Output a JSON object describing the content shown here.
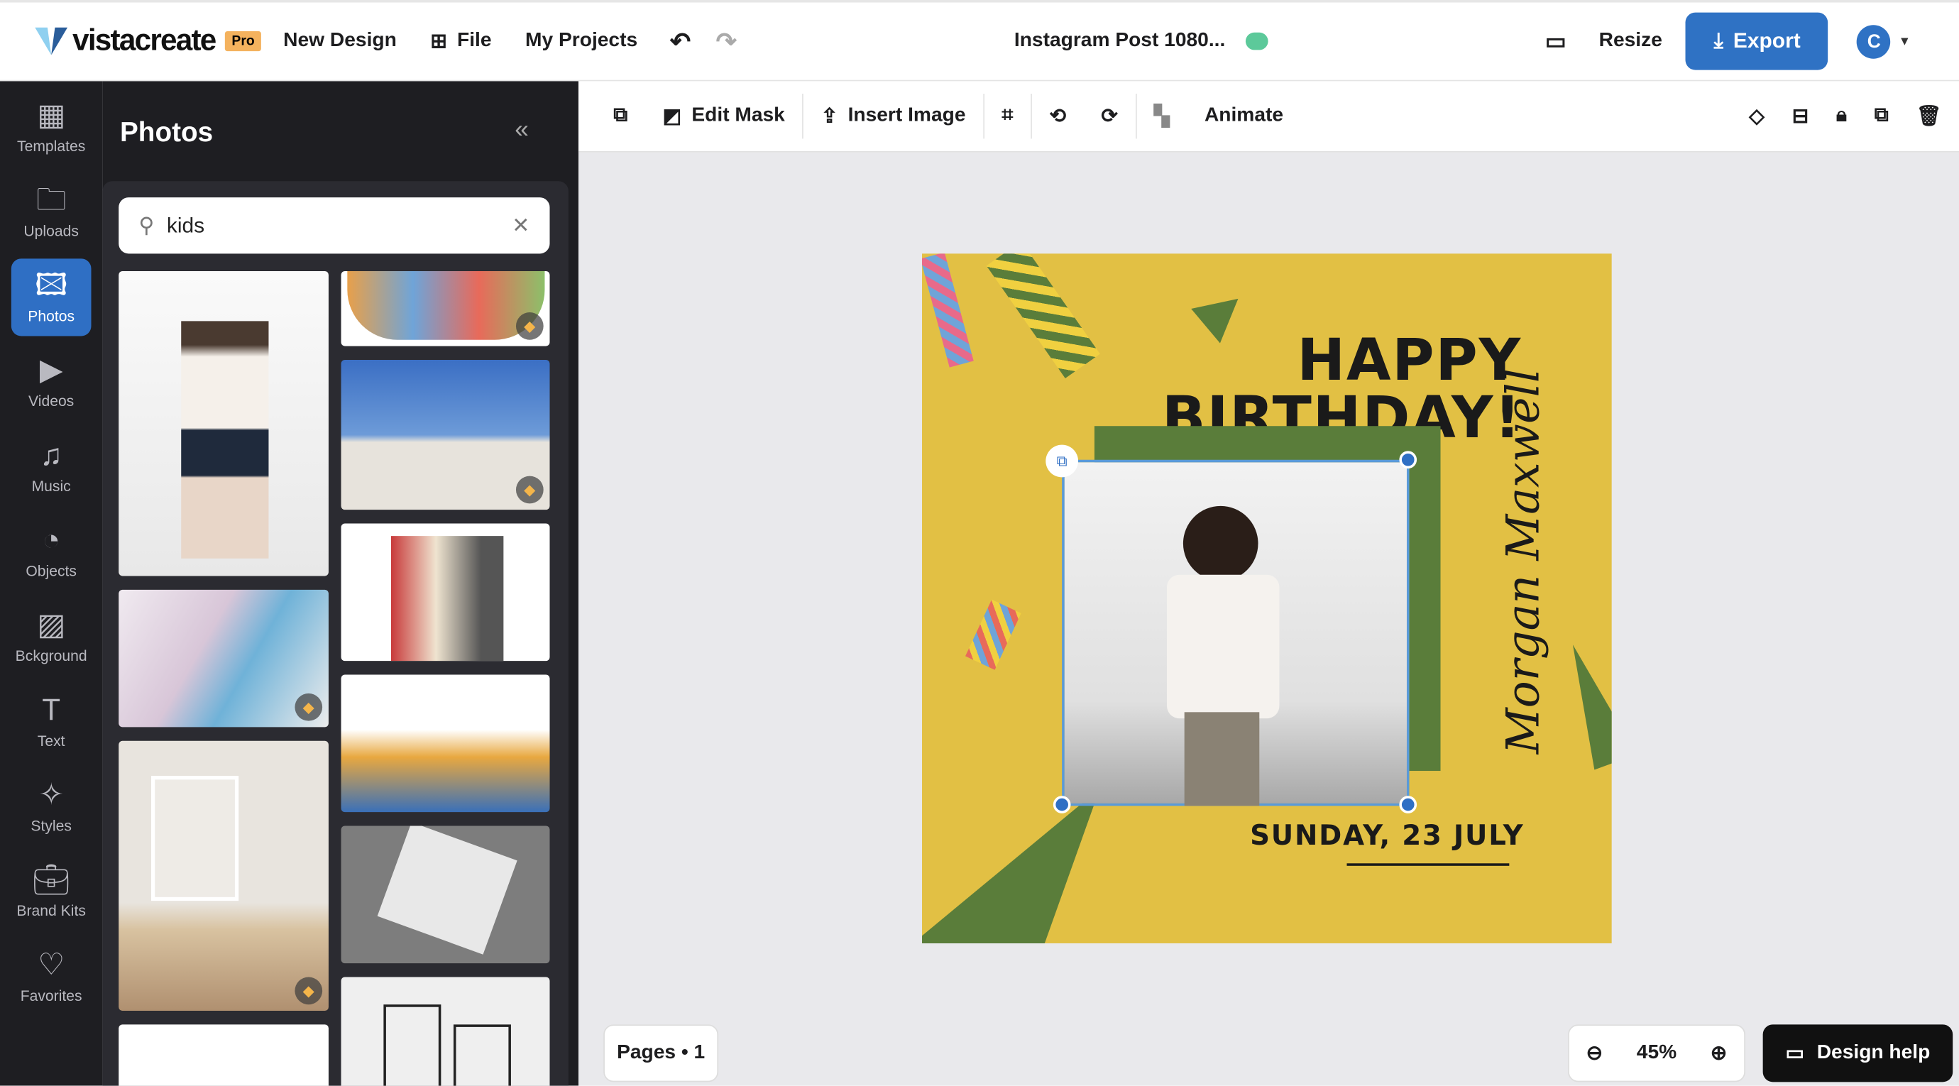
{
  "header": {
    "logo": "vistacreate",
    "plan_badge": "Pro",
    "new_design": "New Design",
    "file": "File",
    "my_projects": "My Projects",
    "doc_title": "Instagram Post 1080...",
    "resize": "Resize",
    "export": "Export",
    "avatar_initial": "C",
    "brand_color": "#2f6fc4"
  },
  "rail": {
    "items": [
      {
        "label": "Templates",
        "icon": "templates-icon"
      },
      {
        "label": "Uploads",
        "icon": "folder-icon"
      },
      {
        "label": "Photos",
        "icon": "image-icon",
        "active": true
      },
      {
        "label": "Videos",
        "icon": "video-icon"
      },
      {
        "label": "Music",
        "icon": "music-icon"
      },
      {
        "label": "Objects",
        "icon": "objects-icon"
      },
      {
        "label": "Bckground",
        "icon": "background-icon"
      },
      {
        "label": "Text",
        "icon": "text-icon"
      },
      {
        "label": "Styles",
        "icon": "sparkle-icon"
      },
      {
        "label": "Brand Kits",
        "icon": "briefcase-icon"
      },
      {
        "label": "Favorites",
        "icon": "heart-icon"
      }
    ]
  },
  "panel": {
    "title": "Photos",
    "search_value": "kids"
  },
  "toolbar": {
    "edit_mask": "Edit Mask",
    "insert_image": "Insert Image",
    "animate": "Animate"
  },
  "design": {
    "title1": "HAPPY",
    "title2": "BIRTHDAY!",
    "name": "Morgan Maxwell",
    "date": "SUNDAY, 23 JULY",
    "bg_color": "#e2c044",
    "accent_color": "#5a7d3a"
  },
  "footer": {
    "pages": "Pages • 1",
    "zoom": "45%",
    "design_help": "Design help"
  }
}
